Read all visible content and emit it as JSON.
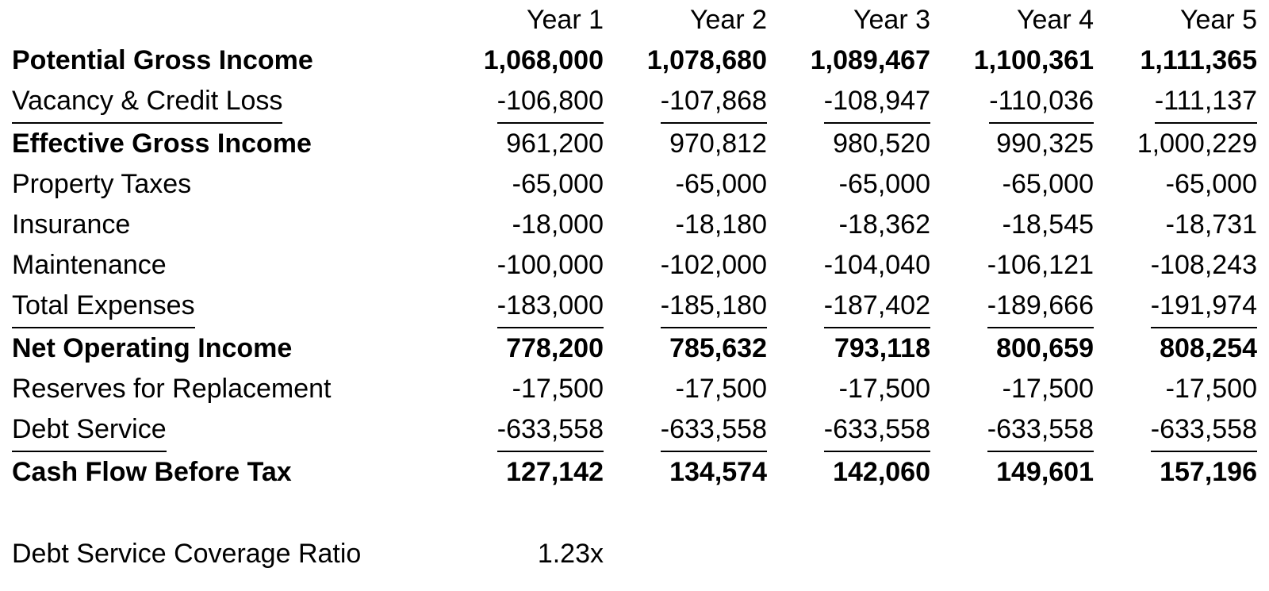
{
  "document": {
    "type": "real-estate-proforma-table",
    "label_column_header": ""
  },
  "table": {
    "column_headers": [
      "Year 1",
      "Year 2",
      "Year 3",
      "Year 4",
      "Year 5"
    ],
    "rows": [
      {
        "label": "Potential Gross Income",
        "style": "bold",
        "values": [
          "1,068,000",
          "1,078,680",
          "1,089,467",
          "1,100,361",
          "1,111,365"
        ]
      },
      {
        "label": "Vacancy & Credit Loss",
        "style": "underline",
        "values": [
          "-106,800",
          "-107,868",
          "-108,947",
          "-110,036",
          "-111,137"
        ]
      },
      {
        "label": "Effective Gross Income",
        "style": "bold-label",
        "values": [
          "961,200",
          "970,812",
          "980,520",
          "990,325",
          "1,000,229"
        ]
      },
      {
        "label": "Property Taxes",
        "style": "normal",
        "values": [
          "-65,000",
          "-65,000",
          "-65,000",
          "-65,000",
          "-65,000"
        ]
      },
      {
        "label": "Insurance",
        "style": "normal",
        "values": [
          "-18,000",
          "-18,180",
          "-18,362",
          "-18,545",
          "-18,731"
        ]
      },
      {
        "label": "Maintenance",
        "style": "normal",
        "values": [
          "-100,000",
          "-102,000",
          "-104,040",
          "-106,121",
          "-108,243"
        ]
      },
      {
        "label": "Total Expenses",
        "style": "underline",
        "values": [
          "-183,000",
          "-185,180",
          "-187,402",
          "-189,666",
          "-191,974"
        ]
      },
      {
        "label": "Net Operating Income",
        "style": "bold",
        "values": [
          "778,200",
          "785,632",
          "793,118",
          "800,659",
          "808,254"
        ]
      },
      {
        "label": "Reserves for Replacement",
        "style": "normal",
        "values": [
          "-17,500",
          "-17,500",
          "-17,500",
          "-17,500",
          "-17,500"
        ]
      },
      {
        "label": "Debt Service",
        "style": "underline",
        "values": [
          "-633,558",
          "-633,558",
          "-633,558",
          "-633,558",
          "-633,558"
        ]
      },
      {
        "label": "Cash Flow Before Tax",
        "style": "bold",
        "values": [
          "127,142",
          "134,574",
          "142,060",
          "149,601",
          "157,196"
        ]
      },
      {
        "label": "",
        "style": "spacer",
        "values": [
          "",
          "",
          "",
          "",
          ""
        ]
      },
      {
        "label": "Debt Service Coverage Ratio",
        "style": "normal",
        "values": [
          "1.23x",
          "",
          "",
          "",
          ""
        ]
      }
    ]
  },
  "colors": {
    "text": "#000000",
    "background": "#ffffff",
    "rule": "#000000"
  }
}
